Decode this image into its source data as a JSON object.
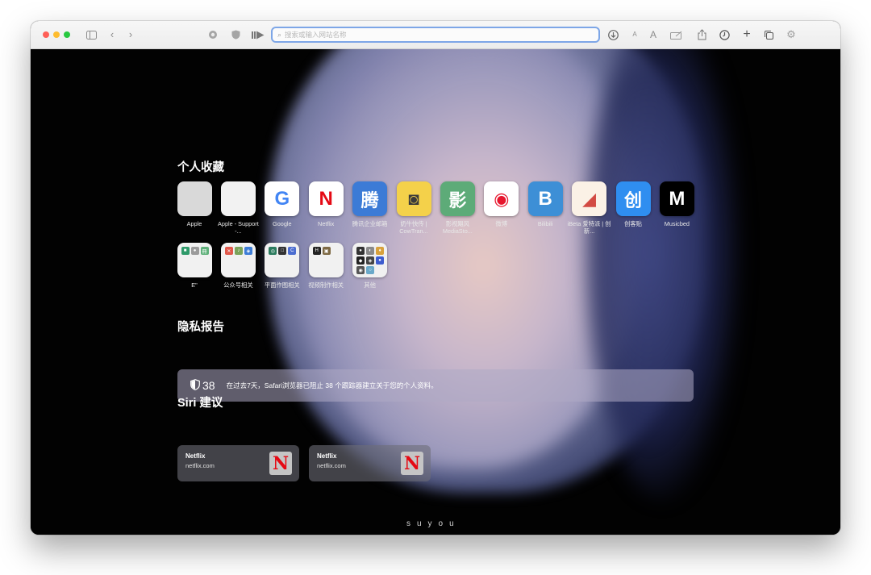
{
  "toolbar": {
    "address_placeholder": "搜索或输入网站名称",
    "font_small": "A",
    "font_large": "A"
  },
  "favorites": {
    "title": "个人收藏",
    "row1": [
      {
        "label": "Apple",
        "glyph": "",
        "bg": "#d9d9d9",
        "color": "#6e6e6e"
      },
      {
        "label": "Apple - Support -...",
        "glyph": "",
        "bg": "#f2f2f2",
        "color": "#6e6e6e"
      },
      {
        "label": "Google",
        "glyph": "G",
        "bg": "#ffffff",
        "color": "#4285f4"
      },
      {
        "label": "Netflix",
        "glyph": "N",
        "bg": "#ffffff",
        "color": "#e50914"
      },
      {
        "label": "腾讯企业邮箱",
        "glyph": "腾",
        "bg": "#3c7bd6",
        "color": "#ffffff"
      },
      {
        "label": "奶牛快传 | CowTran...",
        "glyph": "◙",
        "bg": "#f4d14a",
        "color": "#3a3a3a"
      },
      {
        "label": "影视飓风 MediaSto...",
        "glyph": "影",
        "bg": "#5dab78",
        "color": "#ffffff"
      },
      {
        "label": "微博",
        "glyph": "◉",
        "bg": "#ffffff",
        "color": "#e6162d"
      },
      {
        "label": "Bilibili",
        "glyph": "B",
        "bg": "#3d8fd6",
        "color": "#ffffff"
      },
      {
        "label": "iBeta 爱特派 | 创新...",
        "glyph": "◢",
        "bg": "#fbf1e6",
        "color": "#d24a43"
      },
      {
        "label": "创客贴",
        "glyph": "创",
        "bg": "#2f8ef0",
        "color": "#ffffff"
      },
      {
        "label": "Musicbed",
        "glyph": "M",
        "bg": "#000000",
        "color": "#ffffff"
      }
    ],
    "row2": [
      {
        "label": "E\"",
        "minis": [
          [
            "#2f9a6a",
            "■"
          ],
          [
            "#9b9b9b",
            "●"
          ],
          [
            "#5fb07a",
            "冊"
          ]
        ]
      },
      {
        "label": "公众号相关",
        "minis": [
          [
            "#e0584b",
            "✕"
          ],
          [
            "#7aa35a",
            "♪"
          ],
          [
            "#3e7dd6",
            "◈"
          ]
        ]
      },
      {
        "label": "平面作图相关",
        "minis": [
          [
            "#2c7c5e",
            "◎"
          ],
          [
            "#333333",
            "□"
          ],
          [
            "#4c6dd0",
            "C"
          ]
        ]
      },
      {
        "label": "视频制作相关",
        "minis": [
          [
            "#222222",
            "H"
          ],
          [
            "#7e6a45",
            "▣"
          ]
        ]
      },
      {
        "label": "其他",
        "minis": [
          [
            "#333333",
            "●"
          ],
          [
            "#8a8a8a",
            "◐"
          ],
          [
            "#d8a13b",
            "♦"
          ],
          [
            "#222222",
            "◆"
          ],
          [
            "#444444",
            "◈"
          ],
          [
            "#3d5ccf",
            "●"
          ],
          [
            "#555555",
            "◉"
          ],
          [
            "#6aa9c9",
            "○"
          ]
        ]
      }
    ]
  },
  "privacy": {
    "title": "隐私报告",
    "count": "38",
    "message": "在过去7天，Safari浏览器已阻止 38 个跟踪器建立关于您的个人资料。"
  },
  "siri": {
    "title": "Siri 建议",
    "cards": [
      {
        "title": "Netflix",
        "url": "netflix.com",
        "glyph": "N"
      },
      {
        "title": "Netflix",
        "url": "netflix.com",
        "glyph": "N"
      }
    ]
  },
  "signature": "suyou",
  "colors": {
    "accent": "#7da6e7",
    "privacy_bg": "#afaac4"
  }
}
